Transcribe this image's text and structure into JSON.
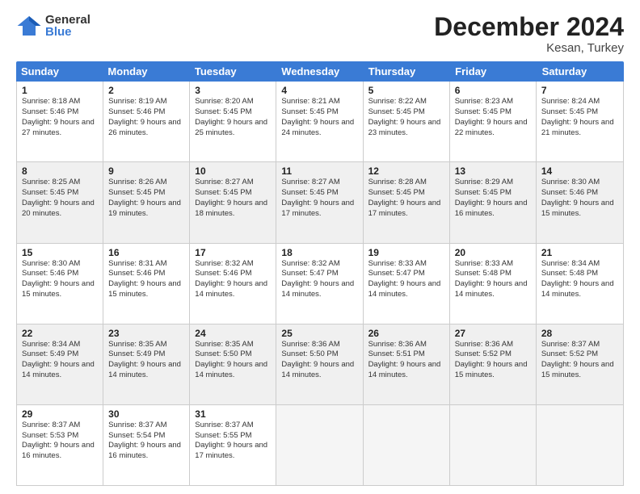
{
  "logo": {
    "general": "General",
    "blue": "Blue"
  },
  "title": "December 2024",
  "location": "Kesan, Turkey",
  "header_days": [
    "Sunday",
    "Monday",
    "Tuesday",
    "Wednesday",
    "Thursday",
    "Friday",
    "Saturday"
  ],
  "rows": [
    [
      {
        "day": "1",
        "sunrise": "Sunrise: 8:18 AM",
        "sunset": "Sunset: 5:46 PM",
        "daylight": "Daylight: 9 hours and 27 minutes.",
        "shaded": false
      },
      {
        "day": "2",
        "sunrise": "Sunrise: 8:19 AM",
        "sunset": "Sunset: 5:46 PM",
        "daylight": "Daylight: 9 hours and 26 minutes.",
        "shaded": false
      },
      {
        "day": "3",
        "sunrise": "Sunrise: 8:20 AM",
        "sunset": "Sunset: 5:45 PM",
        "daylight": "Daylight: 9 hours and 25 minutes.",
        "shaded": false
      },
      {
        "day": "4",
        "sunrise": "Sunrise: 8:21 AM",
        "sunset": "Sunset: 5:45 PM",
        "daylight": "Daylight: 9 hours and 24 minutes.",
        "shaded": false
      },
      {
        "day": "5",
        "sunrise": "Sunrise: 8:22 AM",
        "sunset": "Sunset: 5:45 PM",
        "daylight": "Daylight: 9 hours and 23 minutes.",
        "shaded": false
      },
      {
        "day": "6",
        "sunrise": "Sunrise: 8:23 AM",
        "sunset": "Sunset: 5:45 PM",
        "daylight": "Daylight: 9 hours and 22 minutes.",
        "shaded": false
      },
      {
        "day": "7",
        "sunrise": "Sunrise: 8:24 AM",
        "sunset": "Sunset: 5:45 PM",
        "daylight": "Daylight: 9 hours and 21 minutes.",
        "shaded": false
      }
    ],
    [
      {
        "day": "8",
        "sunrise": "Sunrise: 8:25 AM",
        "sunset": "Sunset: 5:45 PM",
        "daylight": "Daylight: 9 hours and 20 minutes.",
        "shaded": true
      },
      {
        "day": "9",
        "sunrise": "Sunrise: 8:26 AM",
        "sunset": "Sunset: 5:45 PM",
        "daylight": "Daylight: 9 hours and 19 minutes.",
        "shaded": true
      },
      {
        "day": "10",
        "sunrise": "Sunrise: 8:27 AM",
        "sunset": "Sunset: 5:45 PM",
        "daylight": "Daylight: 9 hours and 18 minutes.",
        "shaded": true
      },
      {
        "day": "11",
        "sunrise": "Sunrise: 8:27 AM",
        "sunset": "Sunset: 5:45 PM",
        "daylight": "Daylight: 9 hours and 17 minutes.",
        "shaded": true
      },
      {
        "day": "12",
        "sunrise": "Sunrise: 8:28 AM",
        "sunset": "Sunset: 5:45 PM",
        "daylight": "Daylight: 9 hours and 17 minutes.",
        "shaded": true
      },
      {
        "day": "13",
        "sunrise": "Sunrise: 8:29 AM",
        "sunset": "Sunset: 5:45 PM",
        "daylight": "Daylight: 9 hours and 16 minutes.",
        "shaded": true
      },
      {
        "day": "14",
        "sunrise": "Sunrise: 8:30 AM",
        "sunset": "Sunset: 5:46 PM",
        "daylight": "Daylight: 9 hours and 15 minutes.",
        "shaded": true
      }
    ],
    [
      {
        "day": "15",
        "sunrise": "Sunrise: 8:30 AM",
        "sunset": "Sunset: 5:46 PM",
        "daylight": "Daylight: 9 hours and 15 minutes.",
        "shaded": false
      },
      {
        "day": "16",
        "sunrise": "Sunrise: 8:31 AM",
        "sunset": "Sunset: 5:46 PM",
        "daylight": "Daylight: 9 hours and 15 minutes.",
        "shaded": false
      },
      {
        "day": "17",
        "sunrise": "Sunrise: 8:32 AM",
        "sunset": "Sunset: 5:46 PM",
        "daylight": "Daylight: 9 hours and 14 minutes.",
        "shaded": false
      },
      {
        "day": "18",
        "sunrise": "Sunrise: 8:32 AM",
        "sunset": "Sunset: 5:47 PM",
        "daylight": "Daylight: 9 hours and 14 minutes.",
        "shaded": false
      },
      {
        "day": "19",
        "sunrise": "Sunrise: 8:33 AM",
        "sunset": "Sunset: 5:47 PM",
        "daylight": "Daylight: 9 hours and 14 minutes.",
        "shaded": false
      },
      {
        "day": "20",
        "sunrise": "Sunrise: 8:33 AM",
        "sunset": "Sunset: 5:48 PM",
        "daylight": "Daylight: 9 hours and 14 minutes.",
        "shaded": false
      },
      {
        "day": "21",
        "sunrise": "Sunrise: 8:34 AM",
        "sunset": "Sunset: 5:48 PM",
        "daylight": "Daylight: 9 hours and 14 minutes.",
        "shaded": false
      }
    ],
    [
      {
        "day": "22",
        "sunrise": "Sunrise: 8:34 AM",
        "sunset": "Sunset: 5:49 PM",
        "daylight": "Daylight: 9 hours and 14 minutes.",
        "shaded": true
      },
      {
        "day": "23",
        "sunrise": "Sunrise: 8:35 AM",
        "sunset": "Sunset: 5:49 PM",
        "daylight": "Daylight: 9 hours and 14 minutes.",
        "shaded": true
      },
      {
        "day": "24",
        "sunrise": "Sunrise: 8:35 AM",
        "sunset": "Sunset: 5:50 PM",
        "daylight": "Daylight: 9 hours and 14 minutes.",
        "shaded": true
      },
      {
        "day": "25",
        "sunrise": "Sunrise: 8:36 AM",
        "sunset": "Sunset: 5:50 PM",
        "daylight": "Daylight: 9 hours and 14 minutes.",
        "shaded": true
      },
      {
        "day": "26",
        "sunrise": "Sunrise: 8:36 AM",
        "sunset": "Sunset: 5:51 PM",
        "daylight": "Daylight: 9 hours and 14 minutes.",
        "shaded": true
      },
      {
        "day": "27",
        "sunrise": "Sunrise: 8:36 AM",
        "sunset": "Sunset: 5:52 PM",
        "daylight": "Daylight: 9 hours and 15 minutes.",
        "shaded": true
      },
      {
        "day": "28",
        "sunrise": "Sunrise: 8:37 AM",
        "sunset": "Sunset: 5:52 PM",
        "daylight": "Daylight: 9 hours and 15 minutes.",
        "shaded": true
      }
    ],
    [
      {
        "day": "29",
        "sunrise": "Sunrise: 8:37 AM",
        "sunset": "Sunset: 5:53 PM",
        "daylight": "Daylight: 9 hours and 16 minutes.",
        "shaded": false
      },
      {
        "day": "30",
        "sunrise": "Sunrise: 8:37 AM",
        "sunset": "Sunset: 5:54 PM",
        "daylight": "Daylight: 9 hours and 16 minutes.",
        "shaded": false
      },
      {
        "day": "31",
        "sunrise": "Sunrise: 8:37 AM",
        "sunset": "Sunset: 5:55 PM",
        "daylight": "Daylight: 9 hours and 17 minutes.",
        "shaded": false
      },
      {
        "day": "",
        "sunrise": "",
        "sunset": "",
        "daylight": "",
        "shaded": false,
        "empty": true
      },
      {
        "day": "",
        "sunrise": "",
        "sunset": "",
        "daylight": "",
        "shaded": false,
        "empty": true
      },
      {
        "day": "",
        "sunrise": "",
        "sunset": "",
        "daylight": "",
        "shaded": false,
        "empty": true
      },
      {
        "day": "",
        "sunrise": "",
        "sunset": "",
        "daylight": "",
        "shaded": false,
        "empty": true
      }
    ]
  ]
}
